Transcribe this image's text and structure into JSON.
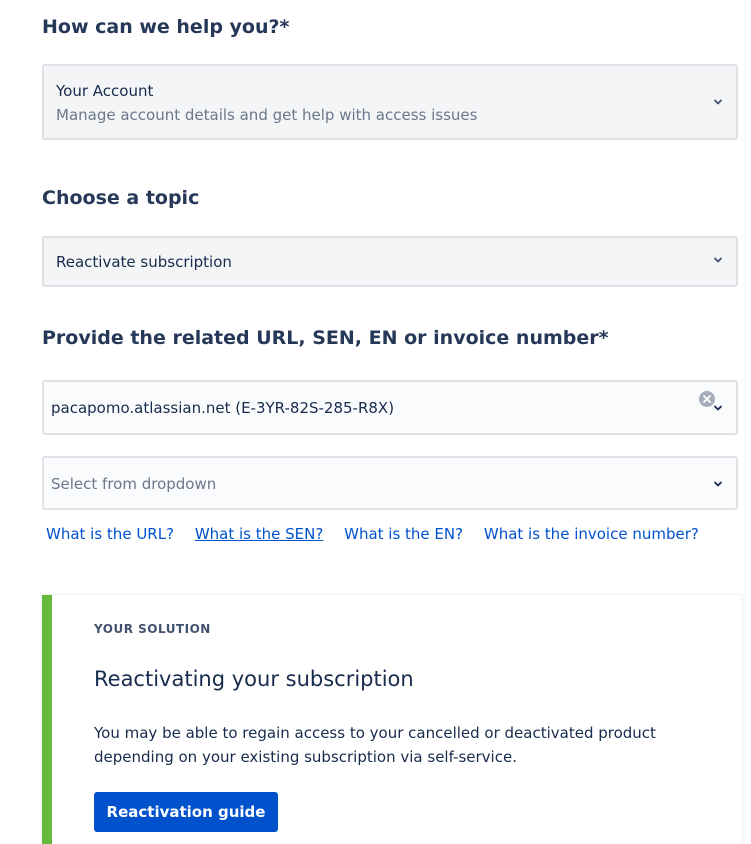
{
  "help": {
    "heading": "How can we help you?*",
    "selected_title": "Your Account",
    "selected_description": "Manage account details and get help with access issues"
  },
  "topic": {
    "heading": "Choose a topic",
    "selected": "Reactivate subscription"
  },
  "related": {
    "heading": "Provide the related URL, SEN, EN or invoice number*",
    "value": "pacapomo.atlassian.net (E-3YR-82S-285-R8X)",
    "dropdown_placeholder": "Select from dropdown"
  },
  "links": {
    "url": "What is the URL?",
    "sen": "What is the SEN?",
    "en": "What is the EN?",
    "invoice": "What is the invoice number?"
  },
  "solution": {
    "kicker": "YOUR SOLUTION",
    "title": "Reactivating your subscription",
    "body": "You may be able to regain access to your cancelled or deactivated product depending on your existing subscription via self-service.",
    "button_label": "Reactivation guide"
  },
  "colors": {
    "accent": "#0052cc",
    "success_bar": "#63ba3c"
  }
}
